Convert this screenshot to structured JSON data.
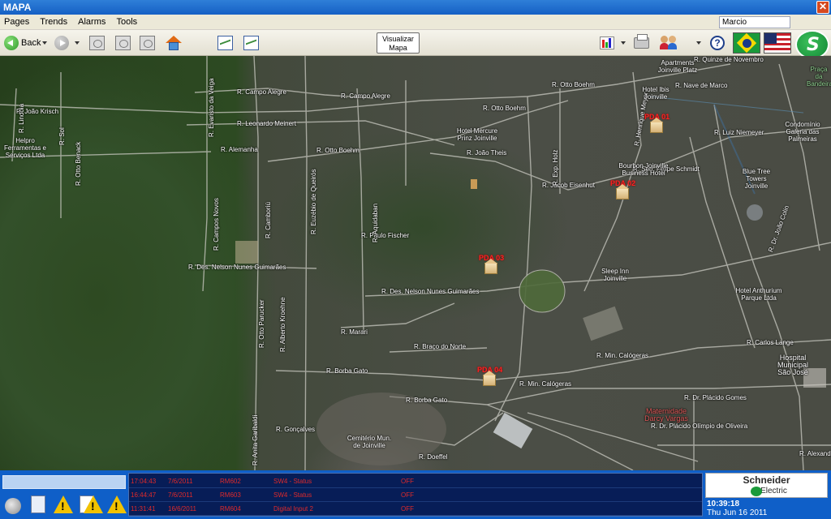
{
  "window": {
    "title": "MAPA",
    "close_label": "✕"
  },
  "menu": {
    "items": [
      "Pages",
      "Trends",
      "Alarms",
      "Tools"
    ],
    "user": "Marcio"
  },
  "toolbar": {
    "back_label": "Back",
    "visualizar_line1": "Visualizar",
    "visualizar_line2": "Mapa"
  },
  "map": {
    "road_labels": [
      "R. Lindóia",
      "R. João Krisch",
      "R. Campo Alegre",
      "R. Campo Alegre",
      "R. Leonardo Meinert",
      "R. Alemanha",
      "R. Otto Boehm",
      "R. Otto Boehm",
      "R. Otto Boehm",
      "R. João Theis",
      "R. Jacob Eisenhut",
      "R. Nave de Marco",
      "R. Luiz Niemeyer",
      "R. Paulo Fischer",
      "R. Des. Nelson Nunes Guimarães",
      "R. Des. Nelson Nunes Guimarães",
      "R. Marari",
      "R. Braço do Norte",
      "R. Borba Gato",
      "R. Borba Gato",
      "R. Carlos Lange",
      "R. Dr. Plácido Gomes",
      "R. Dr. Plácido Olímpio de Oliveira",
      "R. Min. Calógeras",
      "R. Min. Calógeras",
      "R. Alexandre",
      "R. Quinze de Novembro",
      "R. Sen. Felipe Schmidt",
      "R. Gonçalves",
      "R. Doeffel"
    ],
    "vertical_labels": [
      "R. Evaristo da Veiga",
      "R. Otto Benack",
      "R. Sol",
      "R. Campos Novos",
      "R. Camboriú",
      "R. Euzébio de Queirós",
      "R. Aquidaban",
      "R. Henrique Meyer",
      "R. Exp. Holz",
      "R. Otto Parucker",
      "R. Alberto Kroehne",
      "R. Anita Garibaldi",
      "R. Dr. João Colin"
    ],
    "pois": [
      "Hotel Mercure Prinz Joinville",
      "Bourbon Joinville Business Hotel",
      "Sleep Inn Joinville",
      "Hotel Anthurium Parque Ltda",
      "Blue Tree Towers Joinville",
      "Apartments Joinville Platz",
      "Hotel Ibis Joinville",
      "Condomínio Galeria das Palmeiras",
      "Helpro Ferramentas e Serviços Ltda",
      "Cemitério Mun. de Joinville",
      "Hospital Municipal São José",
      "Maternidade Darcy Vargas",
      "Praça da Bandeira"
    ],
    "markers": [
      "PDA 01",
      "PDA 02",
      "PDA 03",
      "PDA 04"
    ]
  },
  "alarms": [
    {
      "time": "17:04:43",
      "date": "7/6/2011",
      "device": "RM602",
      "description": "SW4 - Status",
      "state": "OFF"
    },
    {
      "time": "16:44:47",
      "date": "7/6/2011",
      "device": "RM603",
      "description": "SW4 - Status",
      "state": "OFF"
    },
    {
      "time": "11:31:41",
      "date": "16/6/2011",
      "device": "RM604",
      "description": "Digital Input 2",
      "state": "OFF"
    }
  ],
  "brand": {
    "line1": "Schneider",
    "line2": "Electric"
  },
  "clock": {
    "time": "10:39:18",
    "date": "Thu Jun 16 2011"
  },
  "colors": {
    "title_bar": "#1560c4",
    "alarm_bar": "#0f5fc8",
    "alarm_text": "#e02a2a",
    "marker_label": "#ff2020"
  }
}
